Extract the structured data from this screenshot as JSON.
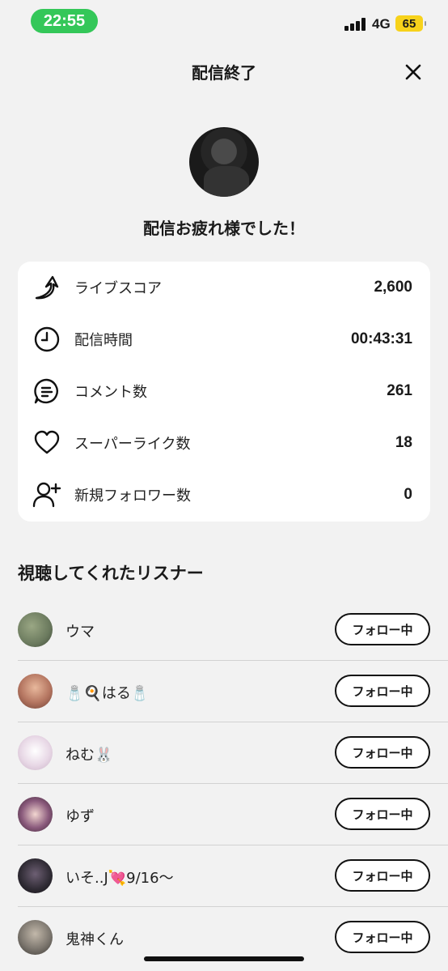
{
  "status": {
    "time": "22:55",
    "network": "4G",
    "battery": "65"
  },
  "header": {
    "title": "配信終了"
  },
  "summary": {
    "message": "配信お疲れ様でした！"
  },
  "stats": [
    {
      "icon": "arrow-up-icon",
      "label": "ライブスコア",
      "value": "2,600"
    },
    {
      "icon": "clock-icon",
      "label": "配信時間",
      "value": "00:43:31"
    },
    {
      "icon": "comment-icon",
      "label": "コメント数",
      "value": "261"
    },
    {
      "icon": "heart-icon",
      "label": "スーパーライク数",
      "value": "18"
    },
    {
      "icon": "add-user-icon",
      "label": "新規フォロワー数",
      "value": "0"
    }
  ],
  "listeners_section": {
    "title": "視聴してくれたリスナー"
  },
  "listeners": [
    {
      "name": "ウマ",
      "button": "フォロー中",
      "avatar_color": "#6b7a5e"
    },
    {
      "name": "🧂🍳はる🧂",
      "button": "フォロー中",
      "avatar_color": "#b47560"
    },
    {
      "name": "ねむ🐰",
      "button": "フォロー中",
      "avatar_color": "#e8d8e6"
    },
    {
      "name": "ゆず",
      "button": "フォロー中",
      "avatar_color": "#8a5a7c"
    },
    {
      "name": "いそ..J💘9/16〜",
      "button": "フォロー中",
      "avatar_color": "#2e2a33"
    },
    {
      "name": "鬼神くん",
      "button": "フォロー中",
      "avatar_color": "#7d776f"
    }
  ]
}
